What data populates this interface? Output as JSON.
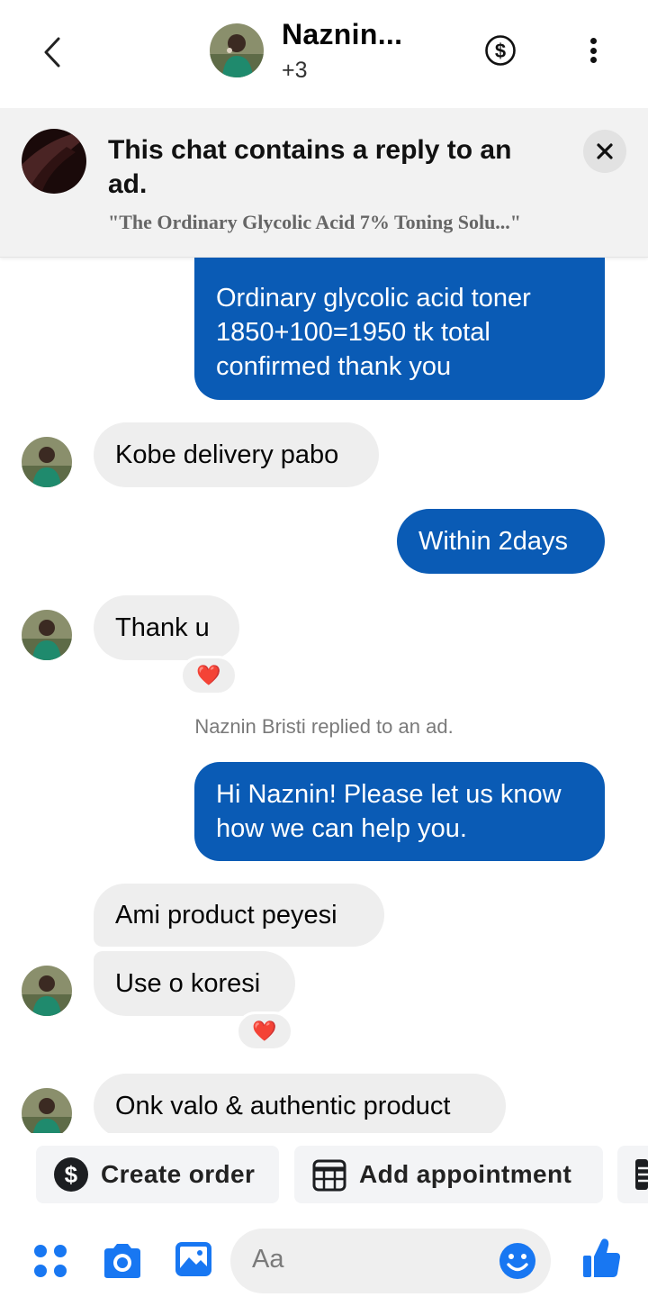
{
  "header": {
    "contact_name": "Naznin...",
    "participants_extra": "+3",
    "icons": {
      "back": "back-arrow-icon",
      "payment": "dollar-circle-icon",
      "menu": "more-vertical-icon"
    }
  },
  "ad_banner": {
    "title": "This chat contains a reply to an ad.",
    "ad_quote": "\"The Ordinary Glycolic Acid 7% Toning Solu...\"",
    "close_icon": "close-icon"
  },
  "messages": [
    {
      "direction": "sent",
      "text": "Ordinary glycolic acid toner 1850+100=1950 tk total confirmed thank you"
    },
    {
      "direction": "received",
      "text": "Kobe delivery pabo"
    },
    {
      "direction": "sent",
      "text": "Within 2days"
    },
    {
      "direction": "received",
      "text": "Thank u",
      "reaction": "❤️"
    },
    {
      "direction": "system",
      "text": "Naznin Bristi replied to an ad."
    },
    {
      "direction": "sent",
      "text": "Hi Naznin! Please let us know how we can help you."
    },
    {
      "direction": "received",
      "text": "Ami product peyesi"
    },
    {
      "direction": "received",
      "text": "Use o koresi",
      "reaction": "❤️"
    },
    {
      "direction": "received",
      "text": "Onk valo & authentic product"
    }
  ],
  "quick_actions": [
    {
      "label": "Create order",
      "icon": "dollar-circle-icon"
    },
    {
      "label": "Add appointment",
      "icon": "calendar-icon"
    }
  ],
  "composer": {
    "placeholder": "Aa",
    "icons": [
      "apps-grid-icon",
      "camera-icon",
      "gallery-icon",
      "emoji-icon",
      "thumbs-up-icon"
    ]
  },
  "colors": {
    "sent_bubble": "#0a5bb5",
    "received_bubble": "#eeeeee",
    "accent": "#1877f2",
    "banner_bg": "#f2f2f2"
  }
}
